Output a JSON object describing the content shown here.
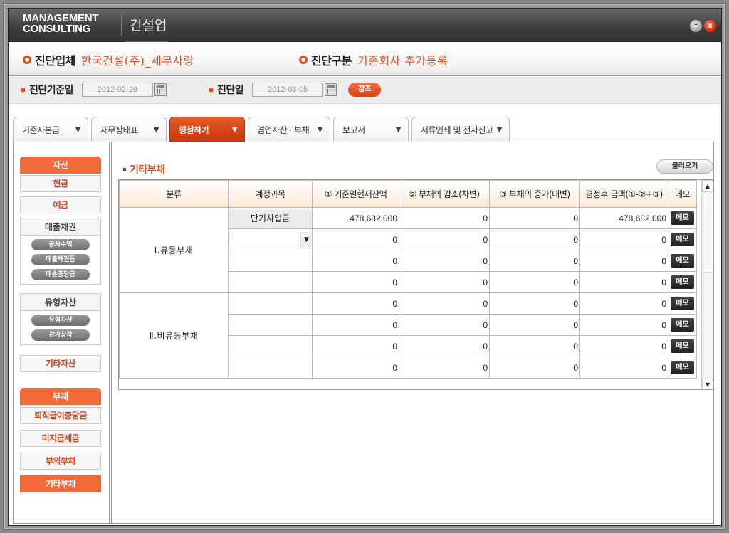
{
  "titlebar": {
    "logo_line1": "MANAGEMENT",
    "logo_line2": "CONSULTING",
    "app_name": "건설업",
    "minimize_icon": "minimize-icon",
    "close_icon": "close-icon",
    "minimize_glyph": "–",
    "close_glyph": "x"
  },
  "info": {
    "company_label": "진단업체",
    "company_value": "한국건설(주)_세무사랑",
    "type_label": "진단구분",
    "type_value": "기존회사 추가등록"
  },
  "dates": {
    "base_date_label": "진단기준일",
    "base_date_value": "2012-02-29",
    "diag_date_label": "진단일",
    "diag_date_value": "2012-03-05",
    "ref_button": "참조"
  },
  "tabs": [
    {
      "label": "기준자본금",
      "arrow": "▼",
      "active": false
    },
    {
      "label": "재무상태표",
      "arrow": "▼",
      "active": false
    },
    {
      "label": "평정하기",
      "arrow": "▼",
      "active": true
    },
    {
      "label": "겸업자산 · 부채",
      "arrow": "▼",
      "active": false
    },
    {
      "label": "보고서",
      "arrow": "▼",
      "active": false
    },
    {
      "label": "서류인쇄 및 전자신고",
      "arrow": "▼",
      "active": false
    }
  ],
  "sidebar": {
    "assets_header": "자산",
    "cash": "현금",
    "deposit": "예금",
    "receivables_group": "매출채권",
    "receivables_items": [
      "공사수익",
      "매출채권등",
      "대손충당금"
    ],
    "tangible_group": "유형자산",
    "tangible_items": [
      "유형자산",
      "감가상각"
    ],
    "other_assets": "기타자산",
    "liabilities_header": "부채",
    "liab_items": [
      "퇴직급여충당금",
      "미지급세금",
      "부외부채",
      "기타부채"
    ],
    "active_item": "기타부채"
  },
  "main": {
    "section_title": "기타부채",
    "load_button": "불러오기",
    "columns": [
      "분류",
      "계정과목",
      "① 기준일현재잔액",
      "② 부채의 감소(차변)",
      "③ 부채의 증가(대변)",
      "평정후 금액(①-②+③)",
      "메모"
    ],
    "memo_label": "메모",
    "combo_arrow": "▼",
    "scroll_up": "▲",
    "scroll_down": "▼",
    "groups": [
      {
        "category": "Ⅰ.유동부채",
        "rows": [
          {
            "account": "단기차입금",
            "balance": "478,682,000",
            "decrease": "0",
            "increase": "0",
            "after": "478,682,000"
          },
          {
            "account": "",
            "combo": true,
            "balance": "0",
            "decrease": "0",
            "increase": "0",
            "after": "0"
          },
          {
            "account": "",
            "balance": "0",
            "decrease": "0",
            "increase": "0",
            "after": "0"
          },
          {
            "account": "",
            "balance": "0",
            "decrease": "0",
            "increase": "0",
            "after": "0"
          }
        ]
      },
      {
        "category": "Ⅱ.비유동부채",
        "rows": [
          {
            "account": "",
            "balance": "0",
            "decrease": "0",
            "increase": "0",
            "after": "0"
          },
          {
            "account": "",
            "balance": "0",
            "decrease": "0",
            "increase": "0",
            "after": "0"
          },
          {
            "account": "",
            "balance": "0",
            "decrease": "0",
            "increase": "0",
            "after": "0"
          },
          {
            "account": "",
            "balance": "0",
            "decrease": "0",
            "increase": "0",
            "after": "0"
          }
        ]
      }
    ]
  },
  "colors": {
    "accent": "#e2501e",
    "sidebar_header": "#f26a3a",
    "active_tab": "#d8431a"
  }
}
